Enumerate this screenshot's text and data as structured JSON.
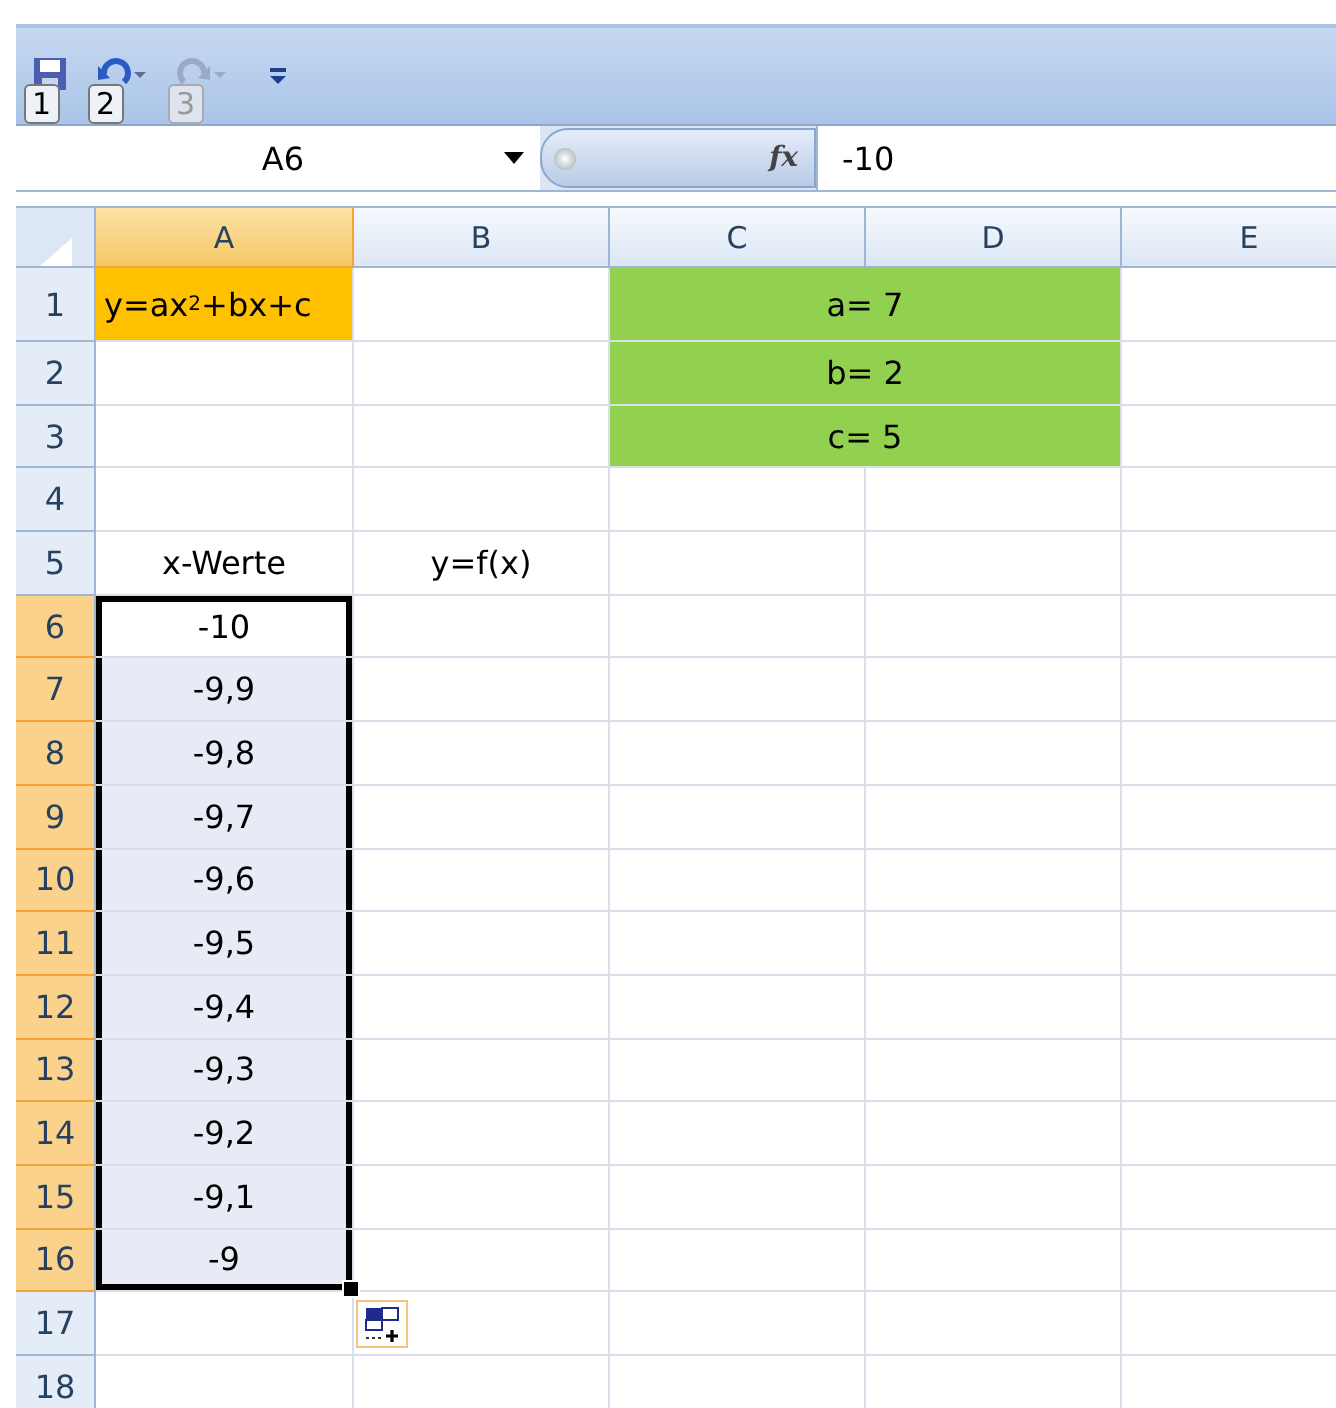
{
  "quick_access": [
    {
      "kind": "save",
      "keytip": "1",
      "disabled": false
    },
    {
      "kind": "undo",
      "keytip": "2",
      "disabled": false
    },
    {
      "kind": "redo",
      "keytip": "3",
      "disabled": true
    }
  ],
  "name_box": {
    "value": "A6"
  },
  "formula_bar": {
    "function_button": "fx",
    "value": "-10"
  },
  "columns": [
    {
      "label": "A",
      "selected": true
    },
    {
      "label": "B",
      "selected": false
    },
    {
      "label": "C",
      "selected": false
    },
    {
      "label": "D",
      "selected": false
    },
    {
      "label": "E",
      "selected": false
    }
  ],
  "rows": [
    {
      "header": "1",
      "selected": false,
      "cells": [
        {
          "text": "y=ax$^{2}$+bx+c",
          "left_aligned": true,
          "color": "#ffc000"
        },
        {},
        {
          "text": "a= 7",
          "merged": true,
          "color": "#92d050"
        }
      ]
    },
    {
      "header": "2",
      "selected": false,
      "cells": [
        {},
        {},
        {
          "text": "b= 2",
          "merged": true,
          "color": "#92d050"
        }
      ]
    },
    {
      "header": "3",
      "selected": false,
      "cells": [
        {},
        {},
        {
          "text": "c= 5",
          "merged": true,
          "color": "#92d050"
        }
      ]
    },
    {
      "header": "4",
      "selected": false
    },
    {
      "header": "5",
      "selected": false,
      "cells": [
        {
          "text": "x-Werte"
        },
        {
          "text": "y=f(x)"
        }
      ]
    },
    {
      "header": "6",
      "selected": true,
      "cells": [
        {
          "text": "-10",
          "active": true
        }
      ]
    },
    {
      "header": "7",
      "selected": true,
      "cells": [
        {
          "text": "-9,9"
        }
      ]
    },
    {
      "header": "8",
      "selected": true,
      "cells": [
        {
          "text": "-9,8"
        }
      ]
    },
    {
      "header": "9",
      "selected": true,
      "cells": [
        {
          "text": "-9,7"
        }
      ]
    },
    {
      "header": "10",
      "selected": true,
      "cells": [
        {
          "text": "-9,6"
        }
      ]
    },
    {
      "header": "11",
      "selected": true,
      "cells": [
        {
          "text": "-9,5"
        }
      ]
    },
    {
      "header": "12",
      "selected": true,
      "cells": [
        {
          "text": "-9,4"
        }
      ]
    },
    {
      "header": "13",
      "selected": true,
      "cells": [
        {
          "text": "-9,3"
        }
      ]
    },
    {
      "header": "14",
      "selected": true,
      "cells": [
        {
          "text": "-9,2"
        }
      ]
    },
    {
      "header": "15",
      "selected": true,
      "cells": [
        {
          "text": "-9,1"
        }
      ]
    },
    {
      "header": "16",
      "selected": true,
      "cells": [
        {
          "text": "-9"
        }
      ]
    },
    {
      "header": "17",
      "selected": false
    },
    {
      "header": "18",
      "selected": false
    }
  ]
}
